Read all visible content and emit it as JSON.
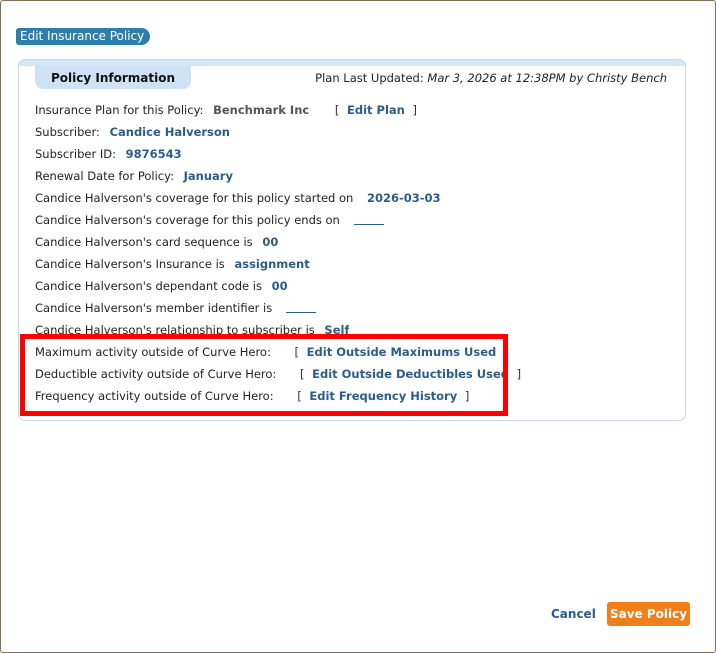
{
  "modal": {
    "title": "Edit Insurance Policy"
  },
  "panel": {
    "tab_label": "Policy Information",
    "plan_updated_label": "Plan Last Updated:",
    "plan_updated_value": "Mar 3, 2026 at 12:38PM by Christy Bench"
  },
  "rows": {
    "plan_label": "Insurance Plan for this Policy:",
    "plan_value": "Benchmark Inc",
    "edit_plan_link": "Edit Plan",
    "subscriber_label": "Subscriber:",
    "subscriber_value": "Candice Halverson",
    "subscriber_id_label": "Subscriber ID:",
    "subscriber_id_value": "9876543",
    "renewal_label": "Renewal Date for Policy:",
    "renewal_value": "January",
    "coverage_start_label": "Candice Halverson's coverage for this policy started on",
    "coverage_start_value": "2026-03-03",
    "coverage_end_label": "Candice Halverson's coverage for this policy ends on",
    "card_sequence_label": "Candice Halverson's card sequence is",
    "card_sequence_value": "00",
    "insurance_label": "Candice Halverson's Insurance is",
    "insurance_value": "assignment",
    "dependant_label": "Candice Halverson's dependant code is",
    "dependant_value": "00",
    "member_label": "Candice Halverson's member identifier is",
    "relationship_label": "Candice Halverson's relationship to subscriber is",
    "relationship_value": "Self",
    "max_activity_label": "Maximum activity outside of Curve Hero:",
    "max_activity_link": "Edit Outside Maximums Used",
    "deductible_activity_label": "Deductible activity outside of Curve Hero:",
    "deductible_activity_link": "Edit Outside Deductibles Used",
    "frequency_activity_label": "Frequency activity outside of Curve Hero:",
    "frequency_activity_link": "Edit Frequency History",
    "bracket_open": "[",
    "bracket_close": "]"
  },
  "footer": {
    "cancel_label": "Cancel",
    "save_label": "Save Policy"
  },
  "colors": {
    "accent": "#2e7ea8",
    "link": "#2a5d8a",
    "save": "#f07f17",
    "highlight": "#ff0000"
  }
}
